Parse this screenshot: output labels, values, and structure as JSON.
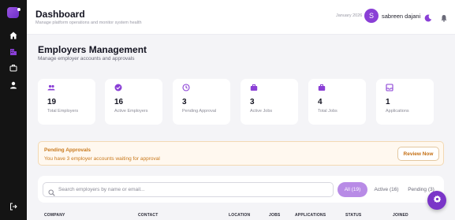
{
  "colors": {
    "accent": "#8a3fd6",
    "sidebar": "#141414",
    "warning": "#c9791c",
    "active_tab": "#b88be6"
  },
  "sidebar": {
    "items": [
      {
        "icon": "logo-icon"
      },
      {
        "icon": "home-icon"
      },
      {
        "icon": "building-icon",
        "active": true
      },
      {
        "icon": "briefcase-icon"
      },
      {
        "icon": "user-icon"
      },
      {
        "icon": "logout-icon"
      }
    ]
  },
  "header": {
    "title": "Dashboard",
    "subtitle": "Manage platform operations and monitor system health",
    "date": "January 2026",
    "avatar_initial": "S",
    "username": "sabreen dajani",
    "theme_icon": "moon-icon",
    "notification_icon": "bell-icon"
  },
  "page": {
    "title": "Employers Management",
    "subtitle": "Manage employer accounts and approvals"
  },
  "stats": [
    {
      "icon": "users-icon",
      "value": "19",
      "label": "Total Employers"
    },
    {
      "icon": "check-circle-icon",
      "value": "16",
      "label": "Active Employers"
    },
    {
      "icon": "clock-icon",
      "value": "3",
      "label": "Pending Approval"
    },
    {
      "icon": "briefcase-icon",
      "value": "3",
      "label": "Active Jobs"
    },
    {
      "icon": "briefcase-icon",
      "value": "4",
      "label": "Total Jobs"
    },
    {
      "icon": "inbox-icon",
      "value": "1",
      "label": "Applications"
    }
  ],
  "pending": {
    "title": "Pending Approvals",
    "text": "You have 3 employer accounts waiting for approval",
    "button": "Review Now"
  },
  "search": {
    "placeholder": "Search employers by name or email...",
    "value": ""
  },
  "filters": [
    {
      "label": "All (19)",
      "active": true
    },
    {
      "label": "Active (16)",
      "active": false
    },
    {
      "label": "Pending (3)",
      "active": false
    }
  ],
  "table": {
    "columns": [
      "COMPANY",
      "CONTACT",
      "LOCATION",
      "JOBS",
      "APPLICATIONS",
      "STATUS",
      "JOINED"
    ]
  },
  "fab": {
    "icon": "gear-icon"
  }
}
